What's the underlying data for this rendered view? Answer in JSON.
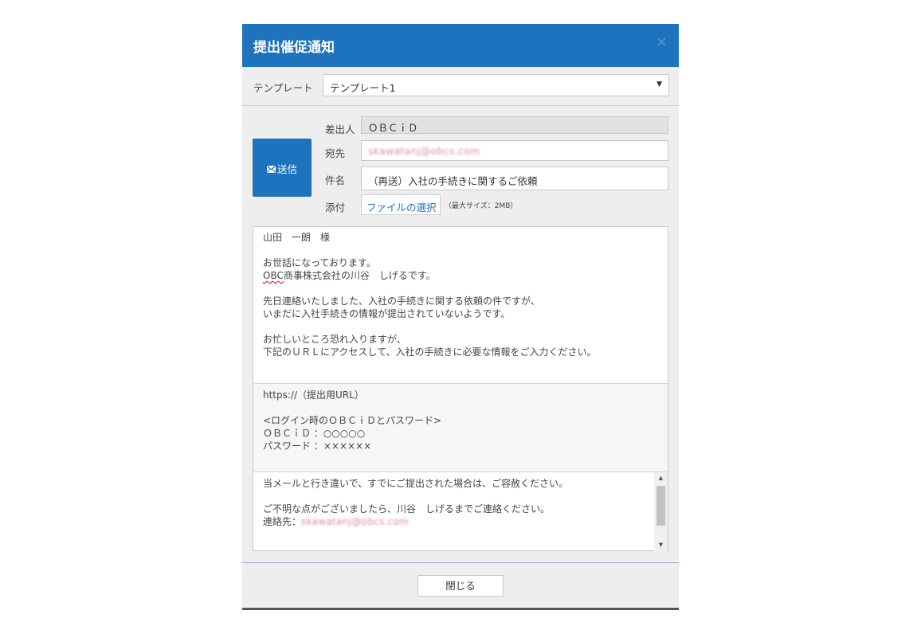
{
  "dialog": {
    "title": "提出催促通知",
    "close_icon": "×"
  },
  "template": {
    "label": "テンプレート",
    "selected": "テンプレート1",
    "arrow": "▼"
  },
  "send_button": {
    "icon": "mail-icon",
    "label": "送信"
  },
  "fields": {
    "sender_label": "差出人",
    "sender_value": "ＯＢＣｉＤ",
    "to_label": "宛先",
    "to_value": "skawatanj@obcs.com",
    "subject_label": "件名",
    "subject_value": "（再送）入社の手続きに関するご依頼",
    "attach_label": "添付",
    "attach_button": "ファイルの選択",
    "attach_note": "（最大サイズ：2MB）"
  },
  "body": {
    "section1": {
      "addressee": "山田　一朗　様",
      "greeting": "お世話になっております。",
      "signature_prefix": "OBC",
      "signature_rest": "商事株式会社の川谷　しげるです。",
      "line1": "先日連絡いたしました、入社の手続きに関する依頼の件ですが、",
      "line2": "いまだに入社手続きの情報が提出されていないようです。",
      "line3": "お忙しいところ恐れ入りますが、",
      "line4": "下記のＵＲＬにアクセスして、入社の手続きに必要な情報をご入力ください。"
    },
    "section2": {
      "url": "https://（提出用URL）",
      "login_header": "<ログイン時のＯＢＣｉＤとパスワード>",
      "obcid": "ＯＢＣｉＤ ：○○○○○",
      "password": "パスワード ：××××××"
    },
    "section3": {
      "line1": "当メールと行き違いで、すでにご提出された場合は、ご容赦ください。",
      "line2": "ご不明な点がございましたら、川谷　しげるまでご連絡ください。",
      "contact_label": "連絡先：",
      "contact_value": "skawatanj@obcs.com"
    }
  },
  "close_button": "閉じる"
}
